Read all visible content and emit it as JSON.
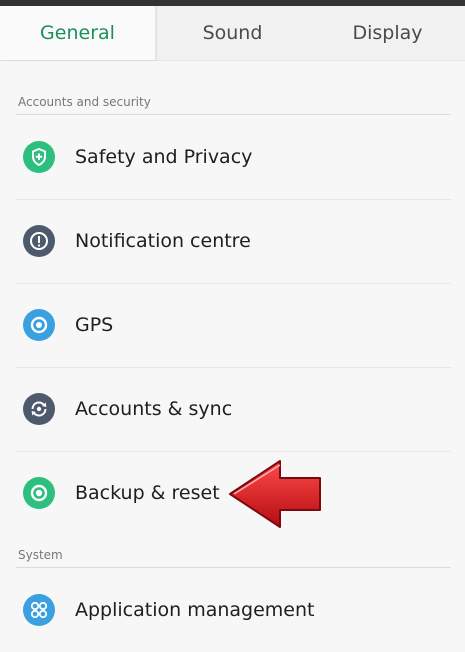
{
  "tabs": [
    {
      "label": "General",
      "active": true
    },
    {
      "label": "Sound",
      "active": false
    },
    {
      "label": "Display",
      "active": false
    }
  ],
  "sections": {
    "accounts_security": "Accounts and security",
    "system": "System"
  },
  "items": [
    {
      "label": "Safety and Privacy",
      "icon": "shield-icon",
      "color": "#2dbf7f"
    },
    {
      "label": "Notification centre",
      "icon": "exclamation-icon",
      "color": "#4d5a6b"
    },
    {
      "label": "GPS",
      "icon": "location-icon",
      "color": "#3aa0e0"
    },
    {
      "label": "Accounts & sync",
      "icon": "sync-icon",
      "color": "#4d5a6b"
    },
    {
      "label": "Backup & reset",
      "icon": "backup-icon",
      "color": "#2dbf7f"
    },
    {
      "label": "Application management",
      "icon": "apps-icon",
      "color": "#3aa0e0"
    }
  ],
  "annotation": {
    "arrow_color": "#d6191f",
    "arrow_target": "Backup & reset"
  }
}
